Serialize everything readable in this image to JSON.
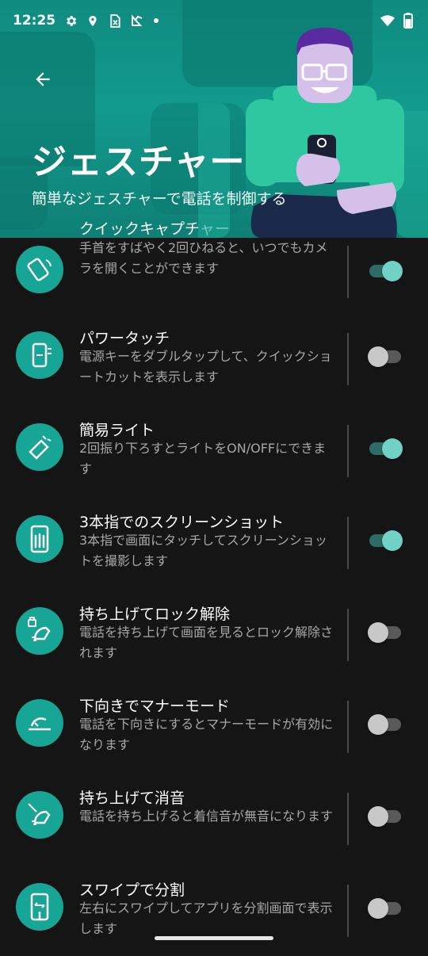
{
  "status_bar": {
    "time": "12:25",
    "icons_left": [
      "gear-icon",
      "location-icon",
      "sim-icon",
      "check-card-icon",
      "dot-icon"
    ],
    "icons_right": [
      "wifi-icon",
      "battery-icon"
    ]
  },
  "header": {
    "title": "ジェスチャー",
    "subtitle": "簡単なジェスチャーで電話を制御する",
    "back_icon": "arrow-back-icon"
  },
  "gestures": [
    {
      "title": "クイックキャプチャー",
      "desc": "手首をすばやく2回ひねると、いつでもカメラを開くことができます",
      "enabled": true,
      "icon": "wrist-twist-icon"
    },
    {
      "title": "パワータッチ",
      "desc": "電源キーをダブルタップして、クイックショートカットを表示します",
      "enabled": false,
      "icon": "power-touch-icon"
    },
    {
      "title": "簡易ライト",
      "desc": "2回振り下ろすとライトをON/OFFにできます",
      "enabled": true,
      "icon": "flashlight-chop-icon"
    },
    {
      "title": "3本指でのスクリーンショット",
      "desc": "3本指で画面にタッチしてスクリーンショットを撮影します",
      "enabled": true,
      "icon": "three-finger-icon"
    },
    {
      "title": "持ち上げてロック解除",
      "desc": "電話を持ち上げて画面を見るとロック解除されます",
      "enabled": false,
      "icon": "lift-unlock-icon"
    },
    {
      "title": "下向きでマナーモード",
      "desc": "電話を下向きにするとマナーモードが有効になります",
      "enabled": false,
      "icon": "flip-silence-icon"
    },
    {
      "title": "持ち上げて消音",
      "desc": "電話を持ち上げると着信音が無音になります",
      "enabled": false,
      "icon": "lift-mute-icon"
    },
    {
      "title": "スワイプで分割",
      "desc": "左右にスワイプしてアプリを分割画面で表示します",
      "enabled": false,
      "icon": "swipe-split-icon"
    }
  ],
  "colors": {
    "header_teal": "#129b8d",
    "icon_teal": "#17a595",
    "toggle_on": "#6fd2c4",
    "background": "#151515"
  }
}
